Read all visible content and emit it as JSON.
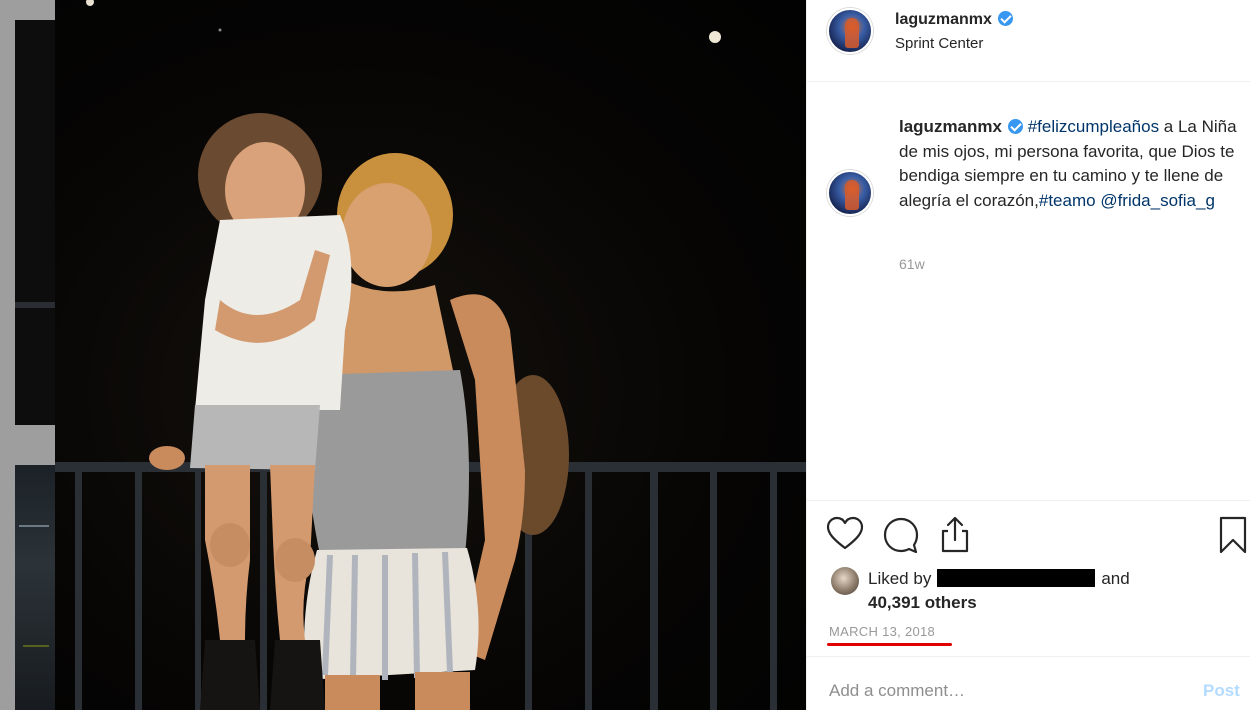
{
  "post": {
    "username": "laguzmanmx",
    "location": "Sprint Center",
    "caption": {
      "hashtag1": "#felizcumpleaños",
      "text1": " a La Niña de mis ojos, mi persona favorita, que Dios te bendiga siempre en tu camino y te llene de alegría el corazón,",
      "hashtag2": "#teamo",
      "mention": "@frida_sofia_g"
    },
    "time_ago": "61w"
  },
  "likes": {
    "prefix": "Liked by",
    "and": "and",
    "count": "40,391 others"
  },
  "date": "MARCH 13, 2018",
  "comment_box": {
    "placeholder": "Add a comment…",
    "post_label": "Post"
  },
  "icons": {
    "like": "heart-icon",
    "comment": "comment-icon",
    "share": "share-icon",
    "save": "bookmark-icon",
    "verified": "verified-badge-icon"
  },
  "colors": {
    "link": "#003569",
    "verified": "#3897f0",
    "muted": "#999999",
    "post_disabled": "#b3dbff",
    "annotation": "#e00000"
  }
}
